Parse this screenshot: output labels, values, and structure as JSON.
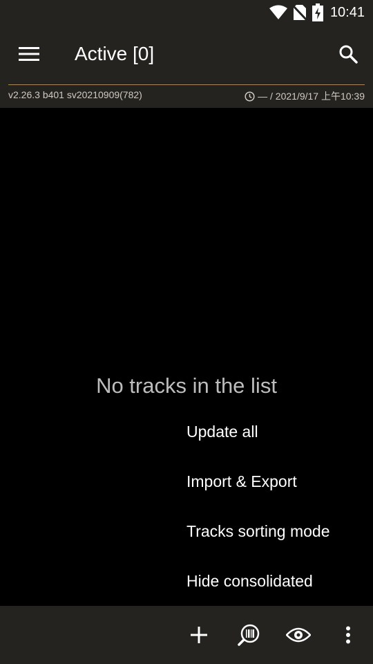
{
  "status_bar": {
    "time": "10:41",
    "icons": [
      "wifi-icon",
      "no-sim-icon",
      "battery-charging-icon"
    ]
  },
  "app_bar": {
    "title": "Active [0]",
    "menu_icon": "hamburger-menu-icon",
    "search_icon": "search-icon"
  },
  "info_bar": {
    "version": "v2.26.3 b401 sv20210909(782)",
    "sync_icon": "clock-icon",
    "sync_text": "— / 2021/9/17 上午10:39"
  },
  "main": {
    "empty_message": "No tracks in the list"
  },
  "overflow_menu": {
    "items": [
      "Update all",
      "Import & Export",
      "Tracks sorting mode",
      "Hide consolidated"
    ]
  },
  "bottom_bar": {
    "icons": [
      "add-icon",
      "barcode-scan-icon",
      "eye-icon",
      "more-vert-icon"
    ]
  },
  "colors": {
    "bar_background": "#252320",
    "content_background": "#000000",
    "accent_divider": "#a98a5c"
  }
}
